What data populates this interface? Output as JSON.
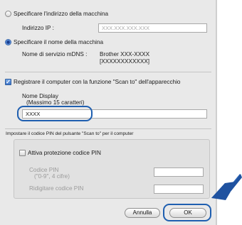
{
  "machine": {
    "option_address": "Specificare l'indirizzo della macchina",
    "ip_label": "Indirizzo IP :",
    "ip_placeholder": "XXX.XXX.XXX.XXX",
    "option_name": "Specificare il nome della macchina",
    "mdns_label": "Nome di servizio mDNS :",
    "mdns_value_line1": "Brother XXX-XXXX",
    "mdns_value_line2": "[XXXXXXXXXXXX]"
  },
  "register": {
    "checkbox_label": "Registrare il computer con la funzione \"Scan to\" dell'apparecchio",
    "display_name_label": "Nome Display",
    "display_name_hint": "(Massimo 15 caratteri)",
    "display_name_value": "XXXX"
  },
  "pin": {
    "section_label": "Impostare il codice PIN del pulsante \"Scan to\" per il computer",
    "protect_label": "Attiva protezione codice PIN",
    "code_label": "Codice PIN",
    "code_hint": "(\"0-9\", 4 cifre)",
    "retype_label": "Ridigitare codice PIN"
  },
  "buttons": {
    "cancel": "Annulla",
    "ok": "OK"
  },
  "colors": {
    "highlight": "#1f5fb0",
    "arrow": "#2a63b5"
  }
}
